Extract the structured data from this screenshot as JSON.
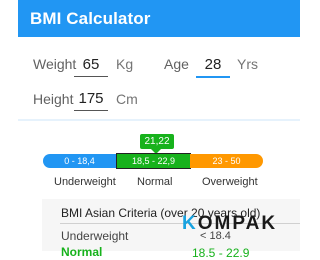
{
  "app": {
    "title": "BMI Calculator"
  },
  "form": {
    "weight_label": "Weight",
    "weight_value": "65",
    "weight_unit": "Kg",
    "age_label": "Age",
    "age_value": "28",
    "age_unit": "Yrs",
    "height_label": "Height",
    "height_value": "175",
    "height_unit": "Cm"
  },
  "result": {
    "bmi_value": "21,22"
  },
  "scale": {
    "segments": [
      {
        "range": "0 - 18,4",
        "label": "Underweight",
        "color": "#2196f3"
      },
      {
        "range": "18,5 - 22,9",
        "label": "Normal",
        "color": "#17b21c"
      },
      {
        "range": "23 - 50",
        "label": "Overweight",
        "color": "#ff9800"
      }
    ]
  },
  "criteria": {
    "title": "BMI Asian Criteria (over 20 years old)",
    "rows": [
      {
        "label": "Underweight",
        "value": "< 18.4"
      },
      {
        "label": "Normal",
        "value": "18.5 - 22.9"
      }
    ]
  },
  "watermark": {
    "prefix": "K",
    "rest": "OMPAK",
    "color": "#17a2e0"
  }
}
